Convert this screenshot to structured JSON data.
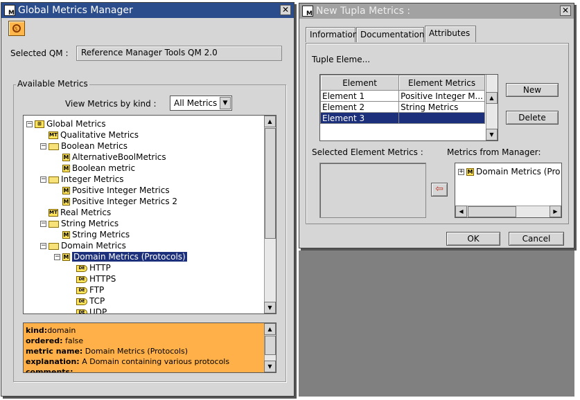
{
  "gmm": {
    "title": "Global Metrics Manager",
    "close": "✕",
    "selected_qm_label": "Selected QM :",
    "selected_qm_value": "Reference Manager Tools QM 2.0",
    "available_label": "Available Metrics",
    "view_by_label": "View Metrics by kind :",
    "view_by_value": "All Metrics",
    "tree": [
      {
        "label": "Global Metrics",
        "icon": "global",
        "depth": 0,
        "exp": "−"
      },
      {
        "label": "Qualitative Metrics",
        "icon": "mt",
        "depth": 1
      },
      {
        "label": "Boolean Metrics",
        "icon": "folder",
        "depth": 1,
        "exp": "−"
      },
      {
        "label": "AlternativeBoolMetrics",
        "icon": "m",
        "depth": 2
      },
      {
        "label": "Boolean metric",
        "icon": "m",
        "depth": 2
      },
      {
        "label": "Integer Metrics",
        "icon": "folder",
        "depth": 1,
        "exp": "−"
      },
      {
        "label": "Positive Integer Metrics",
        "icon": "m",
        "depth": 2
      },
      {
        "label": "Positive Integer Metrics 2",
        "icon": "m",
        "depth": 2
      },
      {
        "label": "Real Metrics",
        "icon": "mt",
        "depth": 1
      },
      {
        "label": "String Metrics",
        "icon": "folder",
        "depth": 1,
        "exp": "−"
      },
      {
        "label": "String Metrics",
        "icon": "m",
        "depth": 2
      },
      {
        "label": "Domain Metrics",
        "icon": "folder",
        "depth": 1,
        "exp": "−"
      },
      {
        "label": "Domain Metrics (Protocols)",
        "icon": "m",
        "depth": 2,
        "exp": "−",
        "selected": true
      },
      {
        "label": "HTTP",
        "icon": "de",
        "depth": 3
      },
      {
        "label": "HTTPS",
        "icon": "de",
        "depth": 3
      },
      {
        "label": "FTP",
        "icon": "de",
        "depth": 3
      },
      {
        "label": "TCP",
        "icon": "de",
        "depth": 3
      },
      {
        "label": "UDP",
        "icon": "de",
        "depth": 3
      }
    ],
    "info": [
      {
        "key": "kind:",
        "value": "domain"
      },
      {
        "key": "ordered:",
        "value": " false"
      },
      {
        "key": "metric name:",
        "value": " Domain Metrics (Protocols)"
      },
      {
        "key": "explanation:",
        "value": " A Domain containing various protocols"
      },
      {
        "key": "comments:",
        "value": ""
      }
    ]
  },
  "ntm": {
    "title": "New Tupla Metrics :",
    "close": "✕",
    "tabs": [
      "Information",
      "Documentation",
      "Attributes"
    ],
    "active_tab": "Attributes",
    "tuple_label": "Tuple Eleme...",
    "columns": [
      "Element",
      "Element Metrics"
    ],
    "rows": [
      [
        "Element 1",
        "Positive Integer M..."
      ],
      [
        "Element 2",
        "String Metrics"
      ],
      [
        "Element 3",
        ""
      ]
    ],
    "new_btn": "New",
    "delete_btn": "Delete",
    "selected_elem_label": "Selected Element Metrics :",
    "from_manager_label": "Metrics from Manager:",
    "manager_item": "Domain Metrics (Pro",
    "ok_btn": "OK",
    "cancel_btn": "Cancel"
  },
  "colors": {
    "selection": "#1c2f7a",
    "info_bg": "#ffb048",
    "title_active": "#2b4d8c"
  }
}
